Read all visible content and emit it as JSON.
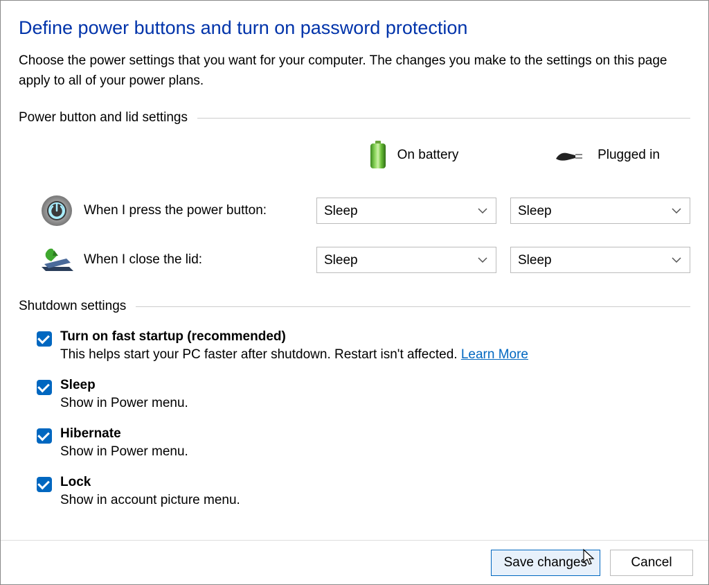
{
  "title": "Define power buttons and turn on password protection",
  "description": "Choose the power settings that you want for your computer. The changes you make to the settings on this page apply to all of your power plans.",
  "sections": {
    "power_lid": {
      "header": "Power button and lid settings",
      "columns": {
        "battery": "On battery",
        "plugged": "Plugged in"
      },
      "rows": {
        "power_button": {
          "label": "When I press the power button:",
          "battery_value": "Sleep",
          "plugged_value": "Sleep"
        },
        "close_lid": {
          "label": "When I close the lid:",
          "battery_value": "Sleep",
          "plugged_value": "Sleep"
        }
      }
    },
    "shutdown": {
      "header": "Shutdown settings",
      "items": {
        "fast_startup": {
          "title": "Turn on fast startup (recommended)",
          "desc": "This helps start your PC faster after shutdown. Restart isn't affected. ",
          "learn_more": "Learn More",
          "checked": true
        },
        "sleep": {
          "title": "Sleep",
          "desc": "Show in Power menu.",
          "checked": true
        },
        "hibernate": {
          "title": "Hibernate",
          "desc": "Show in Power menu.",
          "checked": true
        },
        "lock": {
          "title": "Lock",
          "desc": "Show in account picture menu.",
          "checked": true
        }
      }
    }
  },
  "footer": {
    "save": "Save changes",
    "cancel": "Cancel"
  }
}
